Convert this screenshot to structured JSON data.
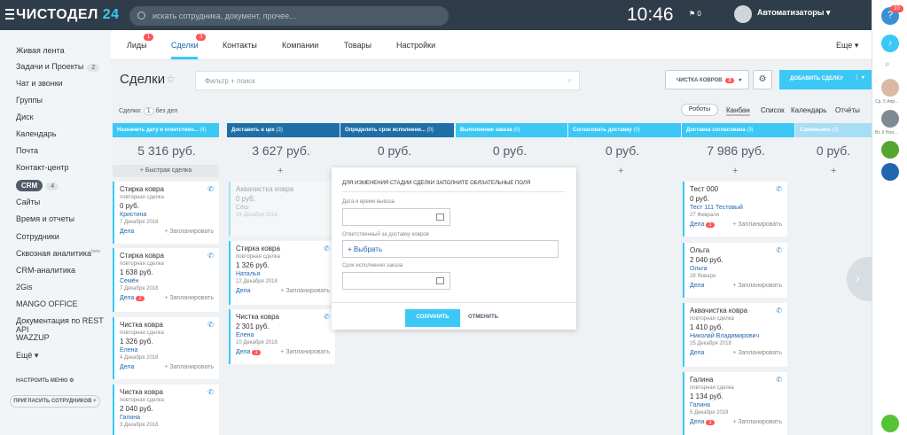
{
  "topbar": {
    "logo_main": "ЧИСТОДЕЛ",
    "logo_num": "24",
    "search_placeholder": "искать сотрудника, документ, прочее...",
    "clock": "10:46",
    "flag_count": "0",
    "org_name": "Автоматизаторы"
  },
  "sidebar": {
    "items": [
      {
        "label": "Живая лента"
      },
      {
        "label": "Задачи и Проекты",
        "badge": "2"
      },
      {
        "label": "Чат и звонки"
      },
      {
        "label": "Группы"
      },
      {
        "label": "Диск"
      },
      {
        "label": "Календарь"
      },
      {
        "label": "Почта"
      },
      {
        "label": "Контакт-центр"
      },
      {
        "label": "CRM",
        "badge": "4"
      },
      {
        "label": "Сайты"
      },
      {
        "label": "Время и отчеты"
      },
      {
        "label": "Сотрудники"
      },
      {
        "label": "Сквозная аналитика",
        "sup": "beta"
      },
      {
        "label": "CRM-аналитика"
      },
      {
        "label": "2Gis"
      },
      {
        "label": "MANGO OFFICE"
      },
      {
        "label": "Документация по REST API"
      },
      {
        "label": "WAZZUP"
      },
      {
        "label": "Ещё"
      }
    ],
    "settings_label": "НАСТРОИТЬ МЕНЮ",
    "invite_label": "ПРИГЛАСИТЬ СОТРУДНИКОВ"
  },
  "tabs": [
    {
      "label": "Лиды",
      "badge": "1"
    },
    {
      "label": "Сделки",
      "badge": "3"
    },
    {
      "label": "Контакты"
    },
    {
      "label": "Компании"
    },
    {
      "label": "Товары"
    },
    {
      "label": "Настройки"
    },
    {
      "label": "Еще"
    }
  ],
  "toolbar": {
    "title": "Сделки",
    "filter_placeholder": "Фильтр + поиск",
    "category_label": "ЧИСТКА КОВРОВ",
    "category_count": "3",
    "add_label": "ДОБАВИТЬ СДЕЛКУ"
  },
  "subbar": {
    "deals_label": "Сделки:",
    "deals_count": "1",
    "no_work": "без дел",
    "robots": "Роботы",
    "views": [
      "Канбан",
      "Список",
      "Календарь",
      "Отчёты"
    ]
  },
  "columns": [
    {
      "name": "Назначить дату и ответствен...",
      "count": "(4)",
      "sum": "5 316 руб.",
      "color": "#3bc8f5"
    },
    {
      "name": "Доставить в цех",
      "count": "(3)",
      "sum": "3 627 руб.",
      "color": "#1e6ea7"
    },
    {
      "name": "Определить срок исполнени...",
      "count": "(0)",
      "sum": "0 руб.",
      "color": "#1e6ea7"
    },
    {
      "name": "Выполнение заказа",
      "count": "(0)",
      "sum": "0 руб.",
      "color": "#3bc8f5"
    },
    {
      "name": "Согласовать доставку",
      "count": "(0)",
      "sum": "0 руб.",
      "color": "#3bc8f5"
    },
    {
      "name": "Доставка согласована",
      "count": "(3)",
      "sum": "7 986 руб.",
      "color": "#3bc8f5"
    },
    {
      "name": "Самовывоз",
      "count": "(0)",
      "sum": "0 руб.",
      "color": "#a6def5"
    }
  ],
  "quick_deal": "+ Быстрая сделка",
  "cards_col1": [
    {
      "title": "Стирка ковра",
      "sub": "повторная сделка",
      "price": "0 руб.",
      "contact": "Кристина",
      "date": "7 Декабря 2018",
      "badge": ""
    },
    {
      "title": "Стирка ковра",
      "sub": "повторная сделка",
      "price": "1 638 руб.",
      "contact": "Семён",
      "date": "7 Декабря 2018",
      "badge": "2"
    },
    {
      "title": "Чистка ковра",
      "sub": "повторная сделка",
      "price": "1 326 руб.",
      "contact": "Елена",
      "date": "4 Декабря 2018",
      "badge": ""
    },
    {
      "title": "Чистка ковра",
      "sub": "повторная сделка",
      "price": "2 040 руб.",
      "contact": "Галина",
      "date": "3 Декабря 2018",
      "badge": ""
    }
  ],
  "cards_col2": [
    {
      "title": "Аквачистка ковра",
      "sub": "повторная сделка",
      "price": "0 руб.",
      "contact": "Сёш",
      "date": "24 Декабря 2018",
      "badge": ""
    },
    {
      "title": "Стирка ковра",
      "sub": "повторная сделка",
      "price": "1 326 руб.",
      "contact": "Наталья",
      "date": "12 Декабря 2018",
      "badge": ""
    },
    {
      "title": "Чистка ковра",
      "sub": "",
      "price": "2 301 руб.",
      "contact": "Елена",
      "date": "10 Декабря 2018",
      "badge": "1"
    }
  ],
  "cards_col6": [
    {
      "title": "Тест 000",
      "sub": "",
      "price": "0 руб.",
      "contact": "Тест 111 Тестовый",
      "date": "27 Февраля",
      "badge": "1"
    },
    {
      "title": "Ольга",
      "sub": "",
      "price": "2 040 руб.",
      "contact": "Ольга",
      "date": "28 Января",
      "badge": ""
    },
    {
      "title": "Аквачистка ковра",
      "sub": "повторная сделка",
      "price": "1 410 руб.",
      "contact": "Николай Владимирович",
      "date": "25 Декабря 2018",
      "badge": ""
    },
    {
      "title": "Галина",
      "sub": "повторная сделка",
      "price": "1 134 руб.",
      "contact": "Галина",
      "date": "5 Декабря 2018",
      "badge": "1"
    }
  ],
  "card_footer": {
    "deals": "Дела",
    "plan": "+ Запланировать"
  },
  "popup": {
    "heading": "ДЛЯ ИЗМЕНЕНИЯ СТАДИИ СДЕЛКИ ЗАПОЛНИТЕ ОБЯЗАТЕЛЬНЫЕ ПОЛЯ",
    "field1_label": "Дата и время вывоза",
    "field2_label": "Ответственный за доставку ковров",
    "field2_value": "+ Выбрать",
    "field3_label": "Срок исполнения заказа",
    "save": "СОХРАНИТЬ",
    "cancel": "ОТМЕНИТЬ"
  },
  "rightbar": {
    "notif_count": "10",
    "chat1_label": "Ср, 5 Апр...",
    "chat2_label": "Вт, 6 Ноя..."
  }
}
